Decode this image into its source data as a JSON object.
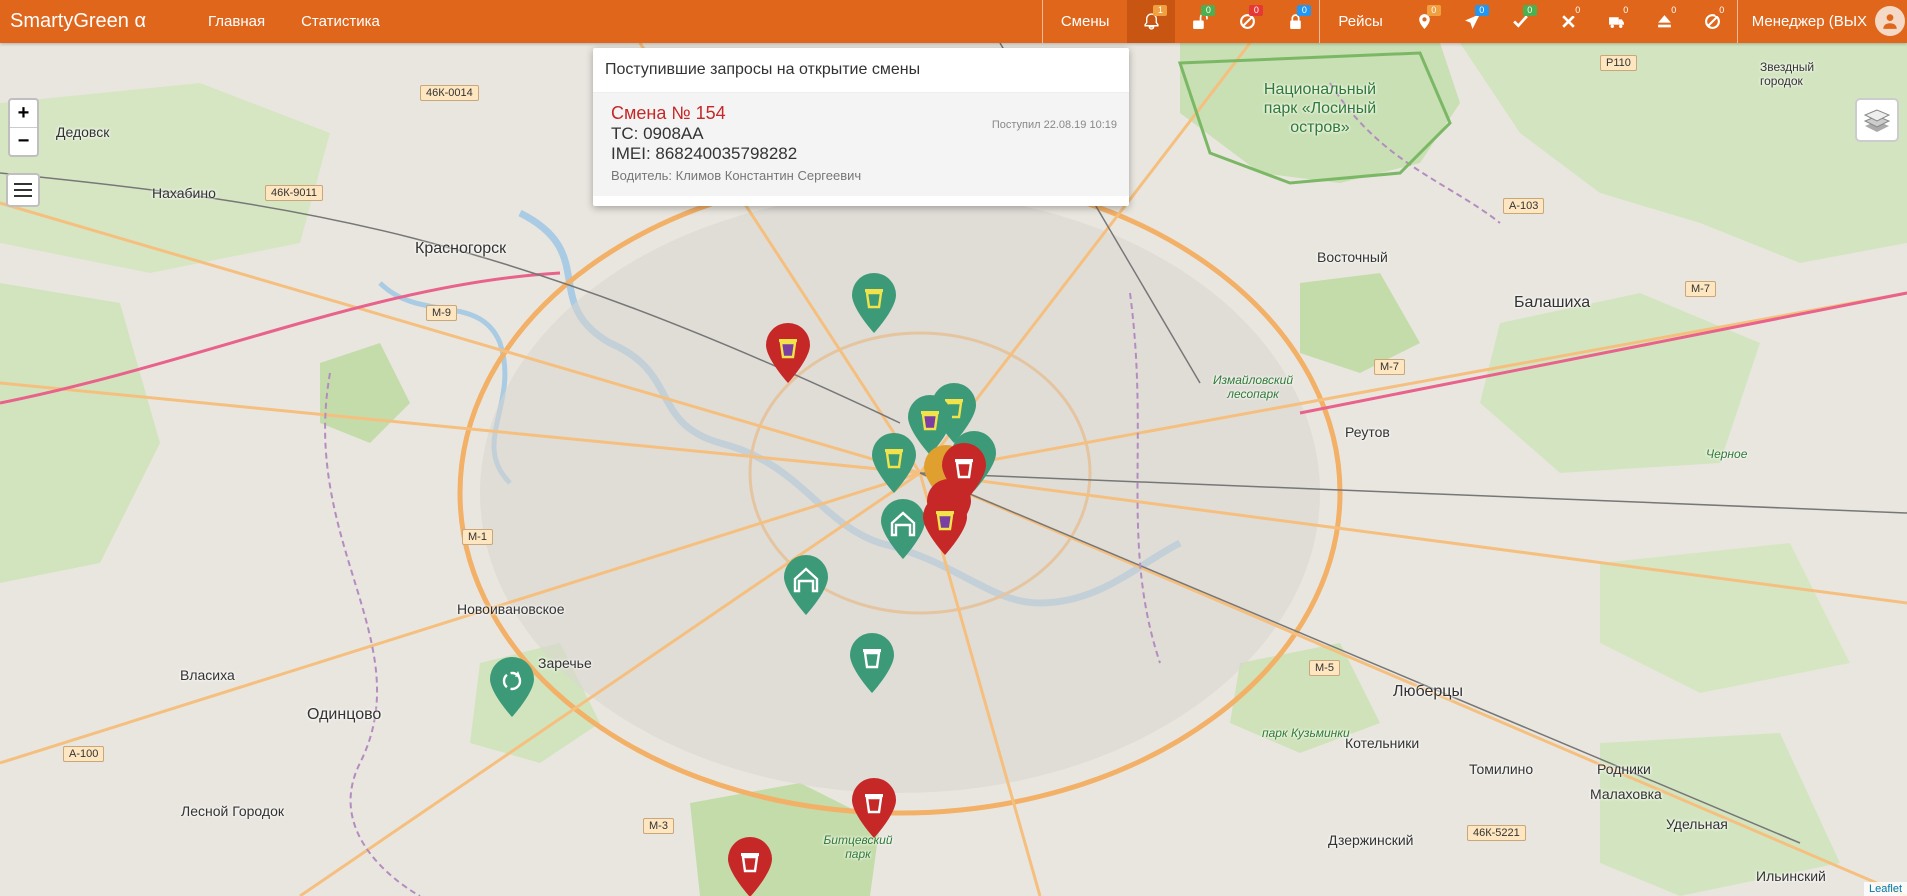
{
  "header": {
    "brand": "SmartyGreen α",
    "nav": [
      "Главная",
      "Статистика"
    ],
    "shifts_label": "Смены",
    "shift_icons": [
      {
        "icon": "bell-icon",
        "badge": "1",
        "badge_color": "#f0a040"
      },
      {
        "icon": "unlock-icon",
        "badge": "0",
        "badge_color": "#4caf50"
      },
      {
        "icon": "ban-icon",
        "badge": "0",
        "badge_color": "#e53935"
      },
      {
        "icon": "lock-icon",
        "badge": "0",
        "badge_color": "#2196f3"
      }
    ],
    "trips_label": "Рейсы",
    "trip_icons": [
      {
        "icon": "map-pin-icon",
        "badge": "0",
        "badge_color": "#f0a040"
      },
      {
        "icon": "send-icon",
        "badge": "0",
        "badge_color": "#2196f3"
      },
      {
        "icon": "check-icon",
        "badge": "0",
        "badge_color": "#4caf50"
      },
      {
        "icon": "cross-icon",
        "badge": "0",
        "badge_color": "#e0661c"
      },
      {
        "icon": "truck-icon",
        "badge": "0",
        "badge_color": "#e0661c"
      },
      {
        "icon": "unload-icon",
        "badge": "0",
        "badge_color": "#e0661c"
      },
      {
        "icon": "ban-icon",
        "badge": "0",
        "badge_color": "#e0661c"
      }
    ],
    "manager": "Менеджер (ВЫХ"
  },
  "popup": {
    "title": "Поступившие запросы на открытие смены",
    "item": {
      "shift": "Смена № 154",
      "vehicle": "ТС: 0908АА",
      "imei": "IMEI: 868240035798282",
      "driver": "Водитель: Климов Константин Сергеевич",
      "received": "Поступил 22.08.19 10:19"
    }
  },
  "map": {
    "zoom_in": "+",
    "zoom_out": "−",
    "attribution": "Leaflet",
    "places": [
      "Дедовск",
      "Нахабино",
      "Красногорск",
      "Новоивановское",
      "Заречье",
      "Власиха",
      "Одинцово",
      "Лесной Городок",
      "Восточный",
      "Балашиха",
      "Реутов",
      "Люберцы",
      "Котельники",
      "Томилино",
      "Родники",
      "Малаховка",
      "Удельная",
      "Дзержинский",
      "Ильинский",
      "Звездный городок"
    ],
    "parks": [
      "Измайловский лесопарк",
      "парк Кузьминки",
      "Битцевский парк",
      "Черное"
    ],
    "national_park": "Национальный парк «Лосиный остров»",
    "roads": [
      "46К-0014",
      "46К-9011",
      "М-9",
      "М-1",
      "А-100",
      "М-3",
      "М-7",
      "А-103",
      "М-5",
      "46К-5221",
      "Р110"
    ],
    "colors": {
      "green_marker": "#3d9a78",
      "red_marker": "#c62828",
      "orange": "#e0661c"
    }
  }
}
